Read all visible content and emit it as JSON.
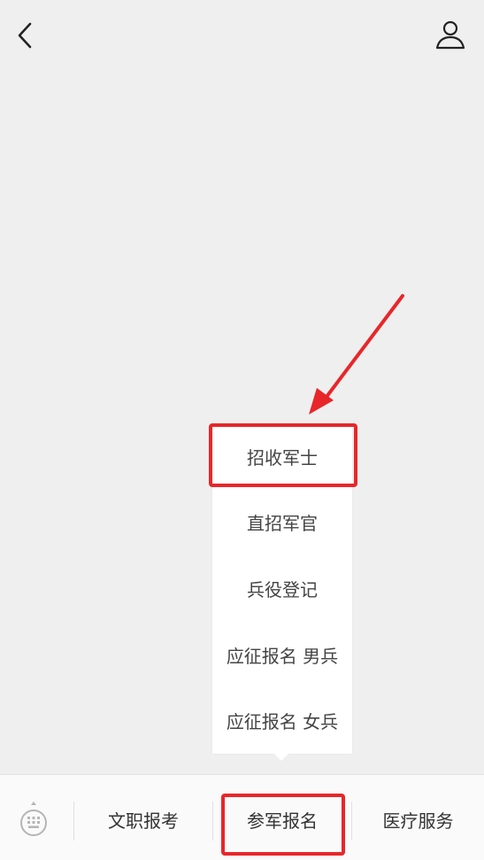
{
  "header": {
    "back_icon": "chevron-left-icon",
    "profile_icon": "user-icon"
  },
  "submenu": {
    "items": [
      {
        "label": "招收军士",
        "highlighted": true
      },
      {
        "label": "直招军官"
      },
      {
        "label": "兵役登记"
      },
      {
        "label": "应征报名 男兵"
      },
      {
        "label": "应征报名 女兵"
      }
    ]
  },
  "bottom_menu": {
    "keyboard_icon": "keyboard-icon",
    "tabs": [
      {
        "label": "文职报考"
      },
      {
        "label": "参军报名",
        "highlighted": true
      },
      {
        "label": "医疗服务"
      }
    ]
  },
  "colors": {
    "background": "#efefef",
    "annotation_red": "#e8262a",
    "menu_bg": "#ffffff",
    "bar_bg": "#fafafa"
  }
}
